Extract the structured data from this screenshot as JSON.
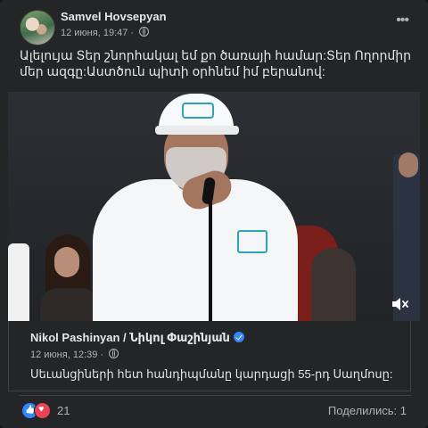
{
  "post": {
    "author": "Samvel Hovsepyan",
    "date": "12 июня, 19:47 ·",
    "text": "Ալելույա Տեր շնորհակալ եմ քո ծառայի համար:Տեր Ողորմիր մեր ազգը:Աստծուն պիտի օրհնեմ իմ բերանով:"
  },
  "icons": {
    "more": "more-options-icon",
    "globe": "globe-icon",
    "mute": "mute-icon",
    "verified": "verified-badge-icon",
    "like": "like-reaction-icon",
    "love": "love-reaction-icon"
  },
  "shared": {
    "author": "Nikol Pashinyan / Նիկոլ Փաշինյան",
    "date": "12 июня, 12:39 ·",
    "text": "Սեւանցիների հետ հանդիպմանը կարդացի 55-րդ Սաղմոսը:"
  },
  "footer": {
    "reaction_count": "21",
    "shares": "Поделились: 1"
  },
  "colors": {
    "background": "#18191a",
    "card": "#242526",
    "text_primary": "#e4e6eb",
    "text_secondary": "#b0b3b8",
    "like_blue": "#2d88ff",
    "love_red": "#f33e58"
  }
}
